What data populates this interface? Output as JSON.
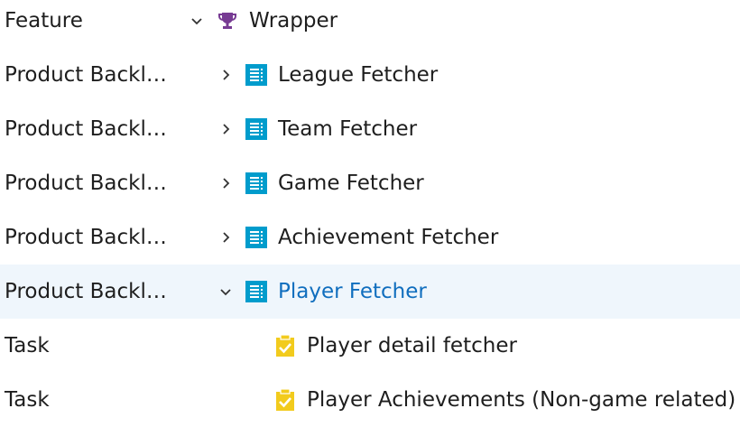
{
  "rows": [
    {
      "type": "Feature",
      "expander": "chevron-down-icon",
      "icon": "trophy-icon",
      "title": "Wrapper",
      "selected": false
    },
    {
      "type": "Product Backl…",
      "expander": "chevron-right-icon",
      "icon": "backlog-item-icon",
      "title": "League Fetcher",
      "selected": false
    },
    {
      "type": "Product Backl…",
      "expander": "chevron-right-icon",
      "icon": "backlog-item-icon",
      "title": "Team Fetcher",
      "selected": false
    },
    {
      "type": "Product Backl…",
      "expander": "chevron-right-icon",
      "icon": "backlog-item-icon",
      "title": "Game Fetcher",
      "selected": false
    },
    {
      "type": "Product Backl…",
      "expander": "chevron-right-icon",
      "icon": "backlog-item-icon",
      "title": "Achievement Fetcher",
      "selected": false
    },
    {
      "type": "Product Backl…",
      "expander": "chevron-down-icon",
      "icon": "backlog-item-icon",
      "title": "Player Fetcher",
      "selected": true
    },
    {
      "type": "Task",
      "expander": "",
      "icon": "task-clipboard-icon",
      "title": "Player detail fetcher",
      "selected": false
    },
    {
      "type": "Task",
      "expander": "",
      "icon": "task-clipboard-icon",
      "title": "Player Achievements (Non-game related)",
      "selected": false
    }
  ],
  "colors": {
    "feature_icon": "#773b93",
    "backlog_icon": "#009ccc",
    "task_icon": "#f2cb1d",
    "selected_row_bg": "#eff6fc",
    "selected_title": "#106ebe",
    "text": "#1e1e1e"
  }
}
